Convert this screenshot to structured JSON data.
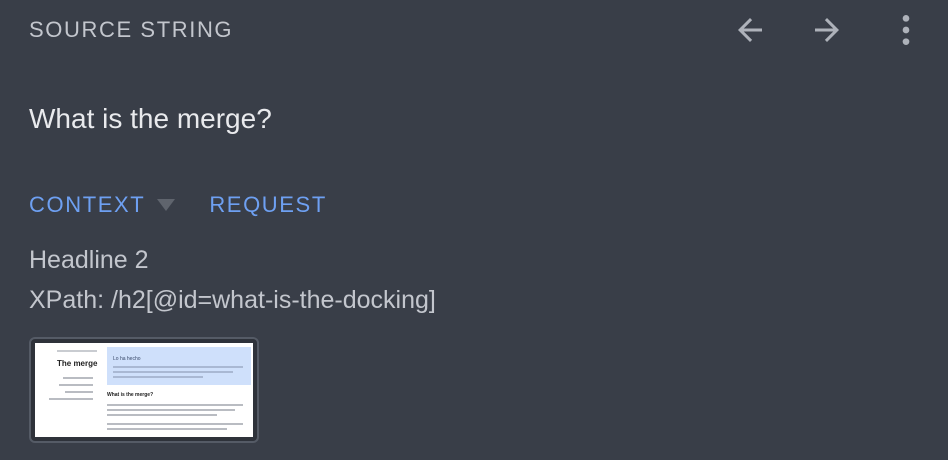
{
  "header": {
    "title": "SOURCE STRING",
    "icons": {
      "back": "arrow-left-icon",
      "forward": "arrow-right-icon",
      "menu": "more-vert-icon"
    }
  },
  "source": {
    "text": "What is the merge?"
  },
  "tabs": [
    {
      "label": "CONTEXT",
      "has_dropdown": true
    },
    {
      "label": "REQUEST",
      "has_dropdown": false
    }
  ],
  "context": {
    "element_type": "Headline 2",
    "xpath": "XPath: /h2[@id=what-is-the-docking]"
  },
  "thumbnail": {
    "page_title": "The merge",
    "banner_title": "Lo ha hecho",
    "section_heading": "What is the merge?"
  },
  "colors": {
    "background": "#393e48",
    "accent": "#6ea0f2",
    "muted_text": "#c3c6cd",
    "primary_text": "#e9eaed"
  }
}
